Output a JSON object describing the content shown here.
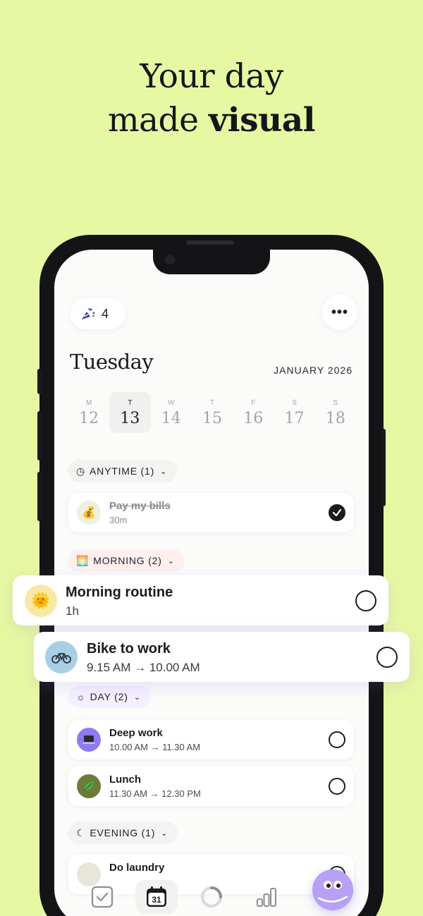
{
  "headline": {
    "line1": "Your day",
    "line2_pre": "made ",
    "line2_bold": "visual"
  },
  "header": {
    "streak_count": "4",
    "more_label": "•••"
  },
  "date": {
    "weekday": "Tuesday",
    "month": "JANUARY 2026"
  },
  "week": [
    {
      "letter": "M",
      "num": "12"
    },
    {
      "letter": "T",
      "num": "13",
      "selected": true
    },
    {
      "letter": "W",
      "num": "14"
    },
    {
      "letter": "T",
      "num": "15"
    },
    {
      "letter": "F",
      "num": "16"
    },
    {
      "letter": "S",
      "num": "17"
    },
    {
      "letter": "S",
      "num": "18"
    }
  ],
  "sections": {
    "anytime": "ANYTIME (1)",
    "morning": "MORNING (2)",
    "day": "DAY (2)",
    "evening": "EVENING (1)"
  },
  "tasks": {
    "bills": {
      "title": "Pay my bills",
      "sub": "30m",
      "done": true
    },
    "routine": {
      "title": "Morning routine",
      "sub": "1h"
    },
    "bike": {
      "title": "Bike to work",
      "sub": "9.15 AM → 10.00 AM"
    },
    "deepwork": {
      "title": "Deep work",
      "sub": "10.00 AM → 11.30 AM"
    },
    "lunch": {
      "title": "Lunch",
      "sub": "11.30 AM → 12.30 PM"
    },
    "laundry": {
      "title": "Do laundry"
    }
  },
  "tabbar": {
    "calendar_day": "31"
  },
  "colors": {
    "background": "#e7f8a3",
    "morning_chip": "#fff0ee",
    "day_chip": "#f5f0ff",
    "bot": "#b6a0f4"
  }
}
